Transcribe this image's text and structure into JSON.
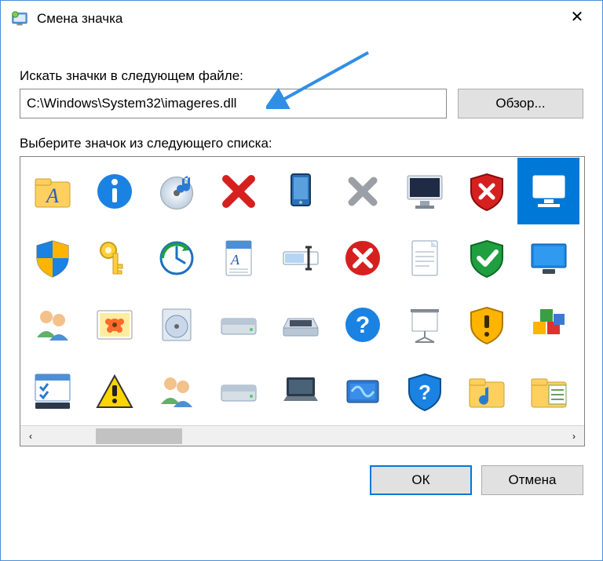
{
  "window": {
    "title": "Смена значка",
    "close": "✕"
  },
  "labels": {
    "searchFile": "Искать значки в следующем файле:",
    "selectIcon": "Выберите значок из следующего списка:"
  },
  "browse": "Обзор...",
  "path": "C:\\Windows\\System32\\imageres.dll",
  "buttons": {
    "ok": "ОК",
    "cancel": "Отмена"
  },
  "scrollbar": {
    "left": "‹",
    "right": "›"
  },
  "icons": [
    "font-folder",
    "info-circle",
    "disc-music",
    "x-red",
    "tablet-device",
    "x-gray",
    "monitor-moon",
    "shield-x-red",
    "computer-blue",
    "shield-uac",
    "key-gold",
    "clock-update",
    "document-font",
    "rename-cursor",
    "error-circle",
    "document-lines",
    "shield-check-green",
    "display-blue",
    "users-group",
    "photo-flower",
    "disc-box",
    "hard-drive",
    "scanner",
    "help-circle",
    "projector-screen",
    "shield-warning",
    "blocks-apps",
    "task-panel",
    "warning-triangle",
    "users-group-alt",
    "hard-drive-alt",
    "laptop-dark",
    "drive-activity",
    "shield-question",
    "folder-music",
    "folder-list"
  ],
  "selectedIndex": 8
}
